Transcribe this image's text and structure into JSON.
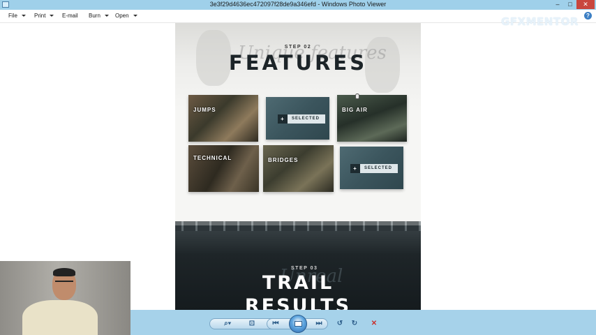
{
  "window": {
    "title": "3e3f29d4636ec472097f28de9a346efd - Windows Photo Viewer",
    "minimize_glyph": "–",
    "maximize_glyph": "□",
    "close_glyph": "✕"
  },
  "menu": {
    "items": [
      {
        "label": "File",
        "has_caret": true
      },
      {
        "label": "Print",
        "has_caret": true
      },
      {
        "label": "E-mail",
        "has_caret": false
      },
      {
        "label": "Burn",
        "has_caret": true
      },
      {
        "label": "Open",
        "has_caret": true
      }
    ],
    "help_glyph": "?"
  },
  "watermark": {
    "text": "GFXMENTOR"
  },
  "photo": {
    "step2_label": "STEP 02",
    "step2_title": "FEATURES",
    "script_text": "Unique features",
    "tiles": [
      {
        "label": "JUMPS"
      },
      {
        "label": "SELECTED",
        "plus": "+"
      },
      {
        "label": "BIG AIR"
      },
      {
        "label": "TECHNICAL"
      },
      {
        "label": "BRIDGES"
      },
      {
        "label": "SELECTED",
        "plus": "+"
      }
    ],
    "step3_label": "STEP 03",
    "step3_title_line1": "TRAIL",
    "step3_title_line2": "RESULTS",
    "step3_script": "Unreal"
  },
  "toolbar": {
    "zoom_glyph": "⌕▾",
    "actual_size_glyph": "⊡",
    "prev_glyph": "⏮",
    "next_glyph": "⏭",
    "rotate_ccw_glyph": "↺",
    "rotate_cw_glyph": "↻",
    "delete_glyph": "✕"
  },
  "colors": {
    "titlebar": "#9fd0ea",
    "toolbar": "#a6d2ea",
    "close_button": "#c9463d",
    "delete_icon": "#c9302c"
  }
}
